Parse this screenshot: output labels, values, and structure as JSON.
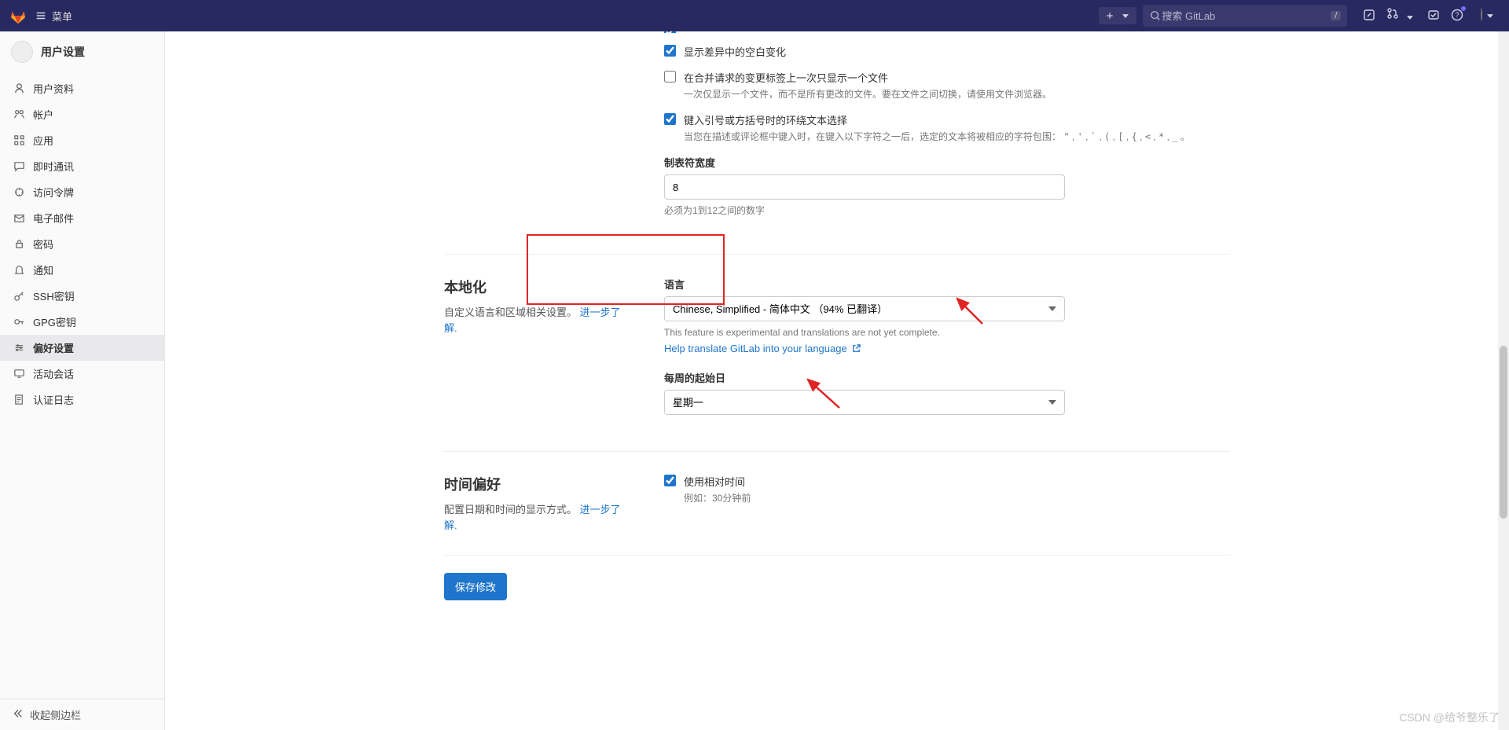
{
  "topbar": {
    "menu_label": "菜单",
    "search_placeholder": "搜索 GitLab",
    "search_kbd": "/"
  },
  "sidebar": {
    "title": "用户设置",
    "items": [
      {
        "label": "用户资料",
        "icon": "profile-icon"
      },
      {
        "label": "帐户",
        "icon": "account-icon"
      },
      {
        "label": "应用",
        "icon": "apps-icon"
      },
      {
        "label": "即时通讯",
        "icon": "chat-icon"
      },
      {
        "label": "访问令牌",
        "icon": "token-icon"
      },
      {
        "label": "电子邮件",
        "icon": "email-icon"
      },
      {
        "label": "密码",
        "icon": "password-icon"
      },
      {
        "label": "通知",
        "icon": "notifications-icon"
      },
      {
        "label": "SSH密钥",
        "icon": "key-icon"
      },
      {
        "label": "GPG密钥",
        "icon": "gpg-icon"
      },
      {
        "label": "偏好设置",
        "icon": "preferences-icon"
      },
      {
        "label": "活动会话",
        "icon": "sessions-icon"
      },
      {
        "label": "认证日志",
        "icon": "authlog-icon"
      }
    ],
    "active_index": 10,
    "collapse_label": "收起侧边栏"
  },
  "behavior": {
    "check_whitespace": {
      "label": "显示差异中的空白变化",
      "checked": true
    },
    "check_onefile": {
      "label": "在合并请求的变更标签上一次只显示一个文件",
      "hint": "一次仅显示一个文件，而不是所有更改的文件。要在文件之间切换，请使用文件浏览器。",
      "checked": false
    },
    "check_surround": {
      "label": "键入引号或方括号时的环绕文本选择",
      "hint_prefix": "当您在描述或评论框中键入时，在键入以下字符之一后，选定的文本将被相应的字符包围：",
      "chars": [
        "\"",
        "'",
        "`",
        "(",
        "[",
        "{",
        "<",
        "*",
        "_"
      ],
      "hint_suffix": "。",
      "checked": true
    },
    "tab_width": {
      "label": "制表符宽度",
      "value": "8",
      "hint": "必须为1到12之间的数字"
    }
  },
  "localization": {
    "title": "本地化",
    "desc": "自定义语言和区域相关设置。",
    "learn_more": "进一步了解.",
    "language_label": "语言",
    "language_value": "Chinese, Simplified - 简体中文  （94% 已翻译）",
    "lang_hint": "This feature is experimental and translations are not yet complete.",
    "translate_link": "Help translate GitLab into your language",
    "week_label": "每周的起始日",
    "week_value": "星期一"
  },
  "time": {
    "title": "时间偏好",
    "desc": "配置日期和时间的显示方式。",
    "learn_more": "进一步了解.",
    "check_relative": {
      "label": "使用相对时间",
      "hint": "例如：30分钟前",
      "checked": true
    }
  },
  "save_label": "保存修改",
  "watermark": "CSDN @给爷整乐了"
}
